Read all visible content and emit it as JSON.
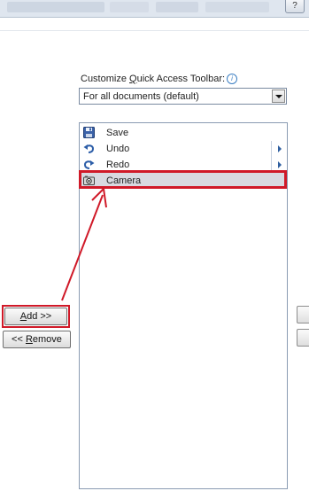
{
  "header": {
    "help_label": "?"
  },
  "customize": {
    "label_prefix": "Customize ",
    "label_accel": "Q",
    "label_suffix": "uick Access Toolbar:",
    "info_glyph": "i",
    "scope_value": "For all documents (default)"
  },
  "qat_items": [
    {
      "label": "Save",
      "icon": "save-icon",
      "submenu": false
    },
    {
      "label": "Undo",
      "icon": "undo-icon",
      "submenu": true
    },
    {
      "label": "Redo",
      "icon": "redo-icon",
      "submenu": true
    },
    {
      "label": "Camera",
      "icon": "camera-icon",
      "submenu": false,
      "selected": true
    }
  ],
  "buttons": {
    "add_accel": "A",
    "add_rest": "dd >>",
    "remove_prefix": "<< ",
    "remove_accel": "R",
    "remove_rest": "emove"
  },
  "colors": {
    "highlight": "#d01928",
    "selection": "#d9d9e0"
  }
}
